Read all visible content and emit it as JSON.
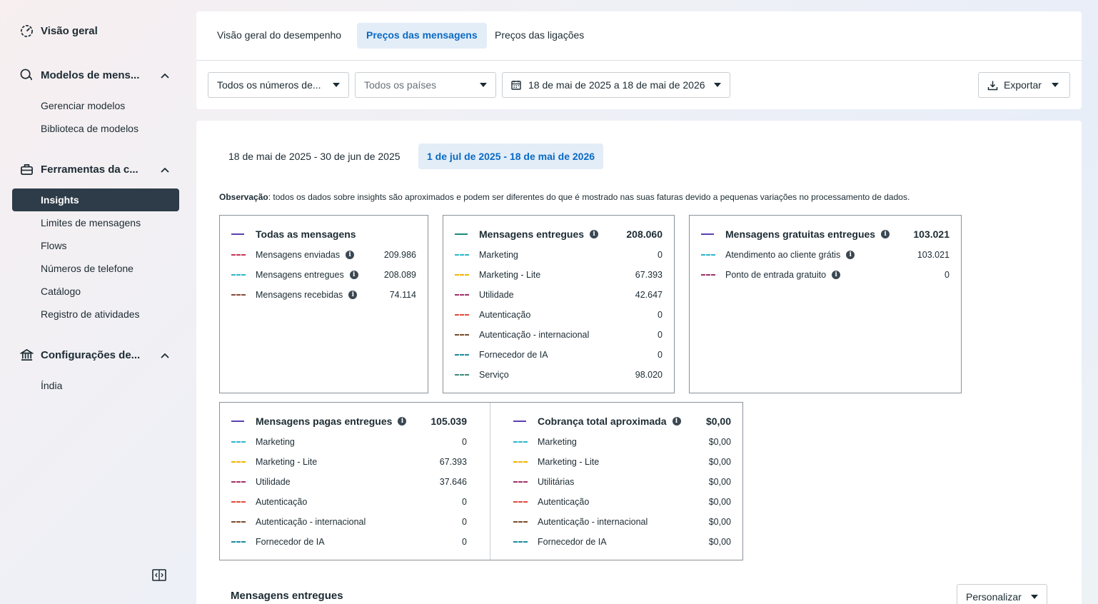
{
  "sidebar": {
    "overview": "Visão geral",
    "sections": [
      {
        "label": "Modelos de mens...",
        "items": [
          "Gerenciar modelos",
          "Biblioteca de modelos"
        ]
      },
      {
        "label": "Ferramentas da c...",
        "items": [
          "Insights",
          "Limites de mensagens",
          "Flows",
          "Números de telefone",
          "Catálogo",
          "Registro de atividades"
        ]
      },
      {
        "label": "Configurações de...",
        "items": [
          "Índia"
        ]
      }
    ]
  },
  "tabs": [
    "Visão geral do desempenho",
    "Preços das mensagens",
    "Preços das ligações"
  ],
  "filters": {
    "numbers": "Todos os números de...",
    "countries": "Todos os países",
    "date_range": "18 de mai de 2025 a 18 de mai de 2026",
    "export": "Exportar"
  },
  "range_tabs": [
    "18 de mai de 2025 - 30 de jun de 2025",
    "1 de jul de 2025 - 18 de mai de 2026"
  ],
  "note": {
    "label": "Observação",
    "text": ": todos os dados sobre insights são aproximados e podem ser diferentes do que é mostrado nas suas faturas devido a pequenas variações no processamento de dados."
  },
  "cards": {
    "all": {
      "title": "Todas as mensagens",
      "color": "#5b3fb0",
      "rows": [
        {
          "label": "Mensagens enviadas",
          "value": "209.986",
          "color": "#c4365a",
          "info": true
        },
        {
          "label": "Mensagens entregues",
          "value": "208.089",
          "color": "#2ab7c9",
          "info": true
        },
        {
          "label": "Mensagens recebidas",
          "value": "74.114",
          "color": "#8a4a3a",
          "info": true
        }
      ]
    },
    "delivered": {
      "title": "Mensagens entregues",
      "total": "208.060",
      "color": "#1a8a7a",
      "rows": [
        {
          "label": "Marketing",
          "value": "0",
          "color": "#2ab7c9"
        },
        {
          "label": "Marketing - Lite",
          "value": "67.393",
          "color": "#f0b400"
        },
        {
          "label": "Utilidade",
          "value": "42.647",
          "color": "#a0306a"
        },
        {
          "label": "Autenticação",
          "value": "0",
          "color": "#e04a3a"
        },
        {
          "label": "Autenticação - internacional",
          "value": "0",
          "color": "#7a4a2a"
        },
        {
          "label": "Fornecedor de IA",
          "value": "0",
          "color": "#1a8aa0"
        },
        {
          "label": "Serviço",
          "value": "98.020",
          "color": "#3a8a7a"
        }
      ]
    },
    "free": {
      "title": "Mensagens gratuitas entregues",
      "total": "103.021",
      "color": "#5b3fb0",
      "rows": [
        {
          "label": "Atendimento ao cliente grátis",
          "value": "103.021",
          "color": "#2ab7c9",
          "info": true
        },
        {
          "label": "Ponto de entrada gratuito",
          "value": "0",
          "color": "#a0306a",
          "info": true
        }
      ]
    },
    "paid": {
      "title": "Mensagens pagas entregues",
      "total": "105.039",
      "color": "#5b3fb0",
      "rows": [
        {
          "label": "Marketing",
          "value": "0",
          "color": "#2ab7c9"
        },
        {
          "label": "Marketing - Lite",
          "value": "67.393",
          "color": "#f0b400"
        },
        {
          "label": "Utilidade",
          "value": "37.646",
          "color": "#a0306a"
        },
        {
          "label": "Autenticação",
          "value": "0",
          "color": "#e04a3a"
        },
        {
          "label": "Autenticação - internacional",
          "value": "0",
          "color": "#7a4a2a"
        },
        {
          "label": "Fornecedor de IA",
          "value": "0",
          "color": "#1a8aa0"
        }
      ]
    },
    "charge": {
      "title": "Cobrança total aproximada",
      "total": "$0,00",
      "color": "#5b3fb0",
      "rows": [
        {
          "label": "Marketing",
          "value": "$0,00",
          "color": "#2ab7c9"
        },
        {
          "label": "Marketing - Lite",
          "value": "$0,00",
          "color": "#f0b400"
        },
        {
          "label": "Utilitárias",
          "value": "$0,00",
          "color": "#a0306a"
        },
        {
          "label": "Autenticação",
          "value": "$0,00",
          "color": "#e04a3a"
        },
        {
          "label": "Autenticação - internacional",
          "value": "$0,00",
          "color": "#7a4a2a"
        },
        {
          "label": "Fornecedor de IA",
          "value": "$0,00",
          "color": "#1a8aa0"
        }
      ]
    }
  },
  "bottom": {
    "title": "Mensagens entregues",
    "customize": "Personalizar"
  }
}
